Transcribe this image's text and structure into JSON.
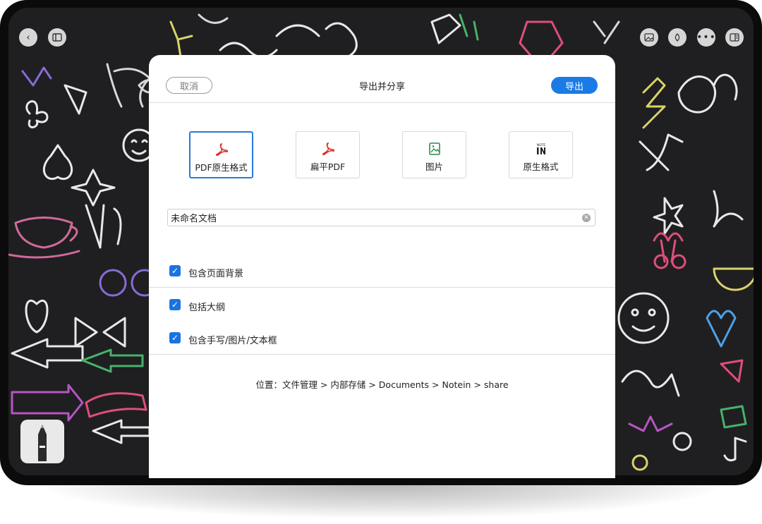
{
  "statusbar": {
    "left_text": "",
    "right_text": ""
  },
  "icons": {
    "back": "back-arrow-icon",
    "sidebar": "sidebar-toggle-icon",
    "image": "image-icon",
    "pen": "pen-icon",
    "more": "more-icon",
    "layout": "layout-icon"
  },
  "dialog": {
    "cancel_label": "取消",
    "title": "导出并分享",
    "export_label": "导出",
    "formats": [
      {
        "label": "PDF原生格式",
        "icon": "pdf-icon",
        "selected": true
      },
      {
        "label": "扁平PDF",
        "icon": "pdf-icon",
        "selected": false
      },
      {
        "label": "图片",
        "icon": "image-icon",
        "selected": false
      },
      {
        "label": "原生格式",
        "icon": "notein-logo-icon",
        "selected": false
      }
    ],
    "filename_value": "未命名文档",
    "options": [
      {
        "label": "包含页面背景",
        "checked": true
      },
      {
        "label": "包括大纲",
        "checked": true
      },
      {
        "label": "包含手写/图片/文本框",
        "checked": true
      }
    ],
    "location": "位置：文件管理 > 内部存储 > Documents > Notein > share"
  },
  "colors": {
    "accent": "#1a7ae6",
    "pdf_red": "#e02b2b",
    "background": "#1f1f21"
  }
}
